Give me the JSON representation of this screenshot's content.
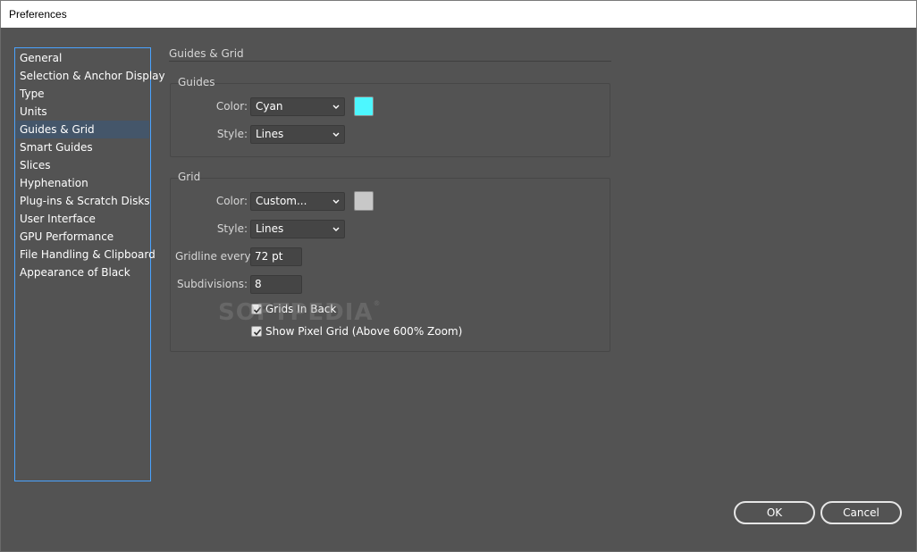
{
  "window": {
    "title": "Preferences"
  },
  "sidebar": {
    "items": [
      {
        "label": "General"
      },
      {
        "label": "Selection & Anchor Display"
      },
      {
        "label": "Type"
      },
      {
        "label": "Units"
      },
      {
        "label": "Guides & Grid",
        "selected": true
      },
      {
        "label": "Smart Guides"
      },
      {
        "label": "Slices"
      },
      {
        "label": "Hyphenation"
      },
      {
        "label": "Plug-ins & Scratch Disks"
      },
      {
        "label": "User Interface"
      },
      {
        "label": "GPU Performance"
      },
      {
        "label": "File Handling & Clipboard"
      },
      {
        "label": "Appearance of Black"
      }
    ]
  },
  "main": {
    "section_title": "Guides & Grid",
    "guides": {
      "title": "Guides",
      "color_label": "Color:",
      "color_value": "Cyan",
      "color_swatch": "#4df7ff",
      "style_label": "Style:",
      "style_value": "Lines"
    },
    "grid": {
      "title": "Grid",
      "color_label": "Color:",
      "color_value": "Custom...",
      "color_swatch": "#c8c8c8",
      "style_label": "Style:",
      "style_value": "Lines",
      "gridline_label": "Gridline every:",
      "gridline_value": "72 pt",
      "subdivisions_label": "Subdivisions:",
      "subdivisions_value": "8",
      "grids_in_back_label": "Grids In Back",
      "grids_in_back_checked": true,
      "pixel_grid_label": "Show Pixel Grid (Above 600% Zoom)",
      "pixel_grid_checked": true
    }
  },
  "watermark": {
    "text": "SOFTPEDIA",
    "mark": "®"
  },
  "buttons": {
    "ok": "OK",
    "cancel": "Cancel"
  }
}
